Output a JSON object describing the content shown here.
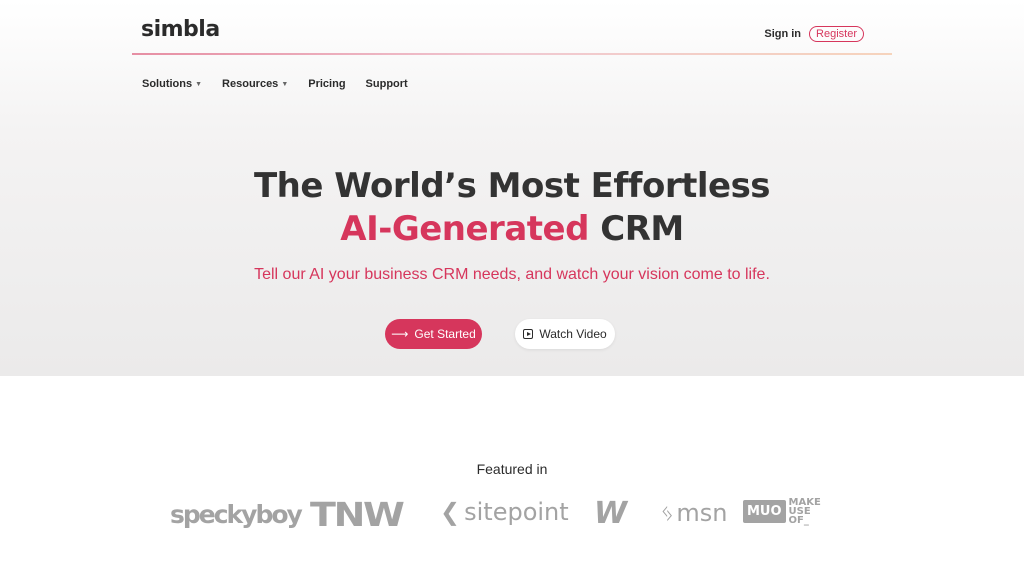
{
  "brand": {
    "logo_text": "simbla"
  },
  "auth": {
    "signin_label": "Sign in",
    "register_label": "Register"
  },
  "nav": {
    "items": [
      {
        "label": "Solutions",
        "has_dropdown": true
      },
      {
        "label": "Resources",
        "has_dropdown": true
      },
      {
        "label": "Pricing",
        "has_dropdown": false
      },
      {
        "label": "Support",
        "has_dropdown": false
      }
    ]
  },
  "hero": {
    "headline_line1": "The World’s Most Effortless",
    "headline_accent": "AI-Generated",
    "headline_rest": " CRM",
    "subtitle": "Tell our AI your business CRM needs, and watch your vision come to life.",
    "primary_cta": "Get Started",
    "secondary_cta": "Watch Video"
  },
  "featured": {
    "heading": "Featured in",
    "logos": [
      {
        "name": "speckyboy",
        "text": "speckyboy"
      },
      {
        "name": "tnw",
        "text": "TNW"
      },
      {
        "name": "sitepoint",
        "text": "sitepoint"
      },
      {
        "name": "w",
        "text": "W"
      },
      {
        "name": "msn",
        "text": "msn"
      },
      {
        "name": "makeuseof",
        "box": "MUO",
        "stack": [
          "MAKE",
          "USE",
          "OF_"
        ]
      }
    ]
  },
  "colors": {
    "accent": "#d6365c",
    "text": "#2b2b2b",
    "logo_gray": "#a3a3a3"
  }
}
